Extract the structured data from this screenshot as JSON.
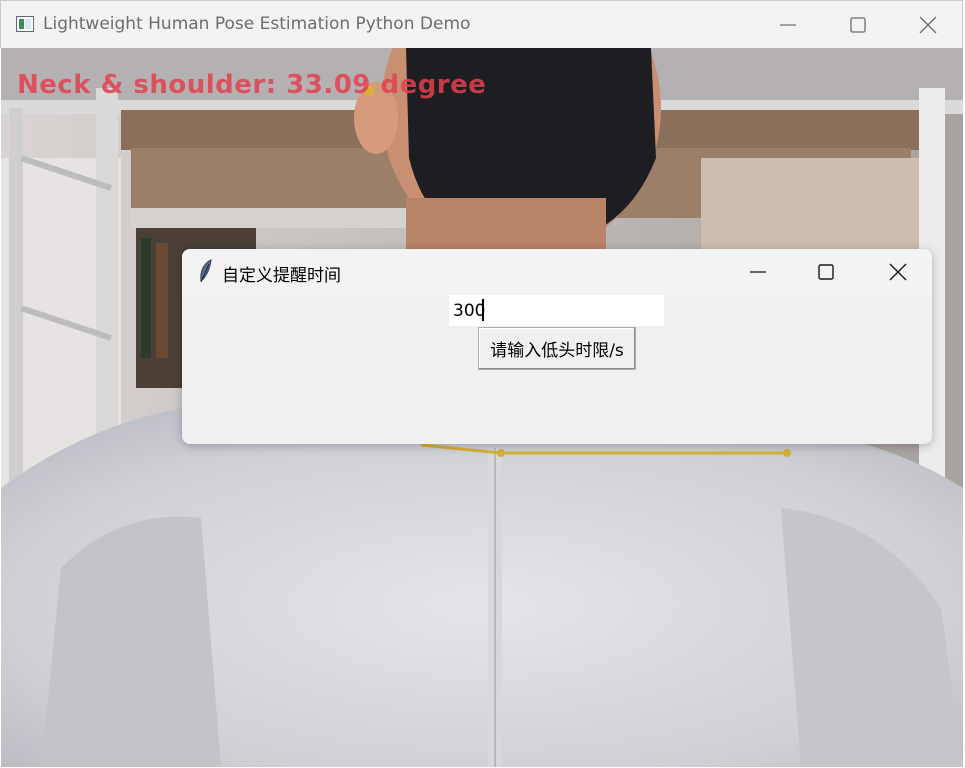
{
  "main_window": {
    "title": "Lightweight Human Pose Estimation Python Demo",
    "controls": {
      "minimize": "minimize-icon",
      "maximize": "maximize-icon",
      "close": "close-icon"
    }
  },
  "camera_feed": {
    "overlay_text": "Neck & shoulder: 33.09 degree",
    "overlay_color": "#e2414f"
  },
  "dialog": {
    "title": "自定义提醒时间",
    "icon": "feather-icon",
    "input_value": "300",
    "button_label": "请输入低头时限/s"
  },
  "colors": {
    "titlebar": "#f3f3f3",
    "dialog_bg": "#f0f0f0",
    "pose_line": "#d6b23a"
  }
}
